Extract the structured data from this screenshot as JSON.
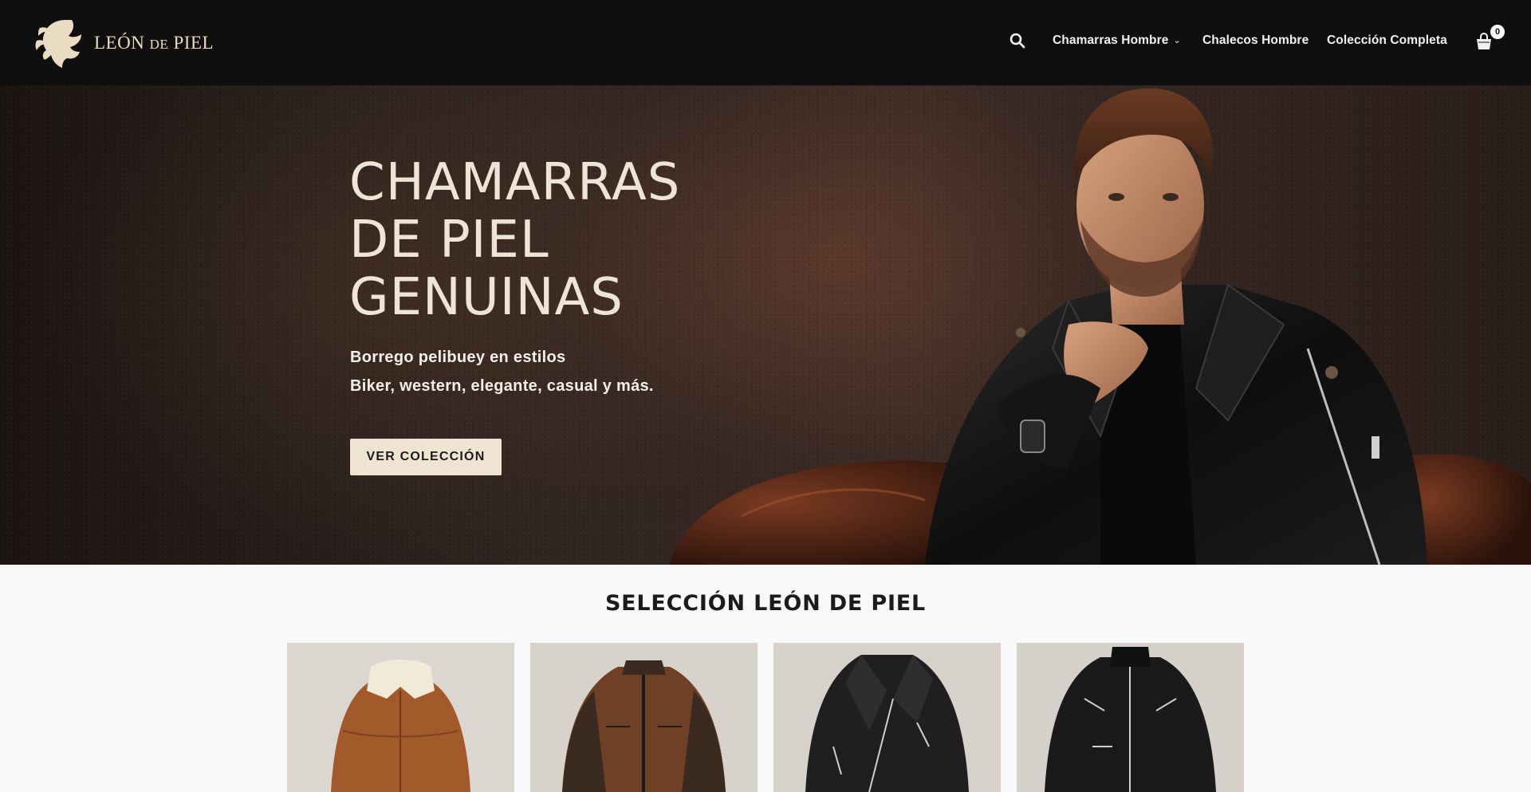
{
  "header": {
    "logo": {
      "word1": "LEÓN",
      "word2": "DE",
      "word3": "PIEL"
    },
    "nav": [
      {
        "label": "Chamarras Hombre",
        "has_dropdown": true
      },
      {
        "label": "Chalecos Hombre",
        "has_dropdown": false
      },
      {
        "label": "Colección Completa",
        "has_dropdown": false
      }
    ],
    "search_icon": "search-icon",
    "cart_icon": "shopping-bag-icon",
    "cart_count": "0"
  },
  "hero": {
    "title_lines": [
      "CHAMARRAS",
      "DE PIEL",
      "GENUINAS"
    ],
    "subtitle_1": "Borrego pelibuey en estilos",
    "subtitle_2": "Biker, western, elegante, casual y más.",
    "cta_label": "VER COLECCIÓN"
  },
  "selection": {
    "title": "SELECCIÓN LEÓN DE PIEL",
    "products": [
      {
        "style": "brown-shearling-collar-jacket",
        "color": "#a35a2a"
      },
      {
        "style": "brown-racer-jacket",
        "color": "#6e4026"
      },
      {
        "style": "black-biker-jacket",
        "color": "#1f1f1f"
      },
      {
        "style": "black-zip-jacket",
        "color": "#1a1a1a"
      }
    ]
  },
  "colors": {
    "header_bg": "#0f0f0f",
    "accent_cream": "#efe3d1",
    "page_bg": "#f8f8f8"
  }
}
